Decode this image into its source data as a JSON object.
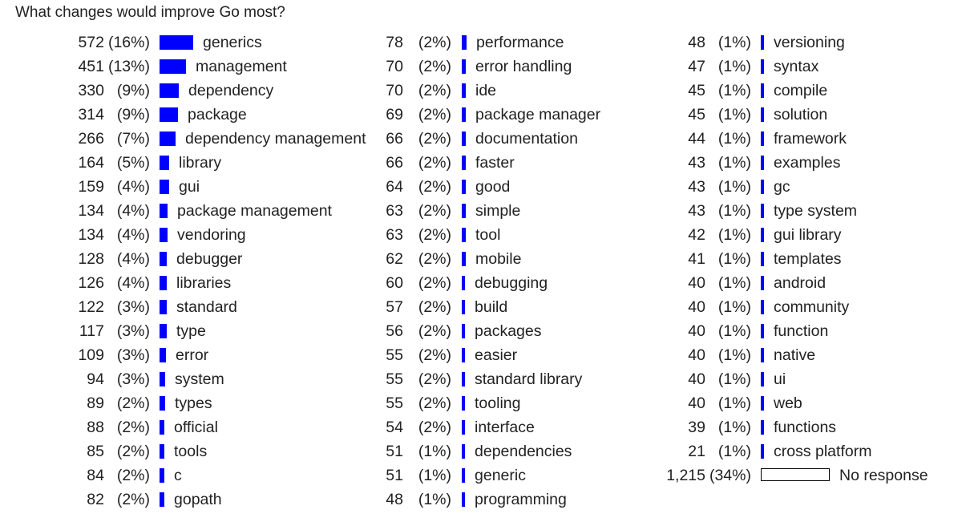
{
  "title": "What changes would improve Go most?",
  "colors": {
    "bar": "#0000ff",
    "no_response_bar": "#ffffff",
    "no_response_border": "#000000"
  },
  "chart_data": {
    "type": "bar",
    "orientation": "horizontal",
    "title": "What changes would improve Go most?",
    "bars": [
      {
        "label": "generics",
        "count": "572",
        "percent": "(16%)",
        "value": 572
      },
      {
        "label": "management",
        "count": "451",
        "percent": "(13%)",
        "value": 451
      },
      {
        "label": "dependency",
        "count": "330",
        "percent": "(9%)",
        "value": 330
      },
      {
        "label": "package",
        "count": "314",
        "percent": "(9%)",
        "value": 314
      },
      {
        "label": "dependency management",
        "count": "266",
        "percent": "(7%)",
        "value": 266
      },
      {
        "label": "library",
        "count": "164",
        "percent": "(5%)",
        "value": 164
      },
      {
        "label": "gui",
        "count": "159",
        "percent": "(4%)",
        "value": 159
      },
      {
        "label": "package management",
        "count": "134",
        "percent": "(4%)",
        "value": 134
      },
      {
        "label": "vendoring",
        "count": "134",
        "percent": "(4%)",
        "value": 134
      },
      {
        "label": "debugger",
        "count": "128",
        "percent": "(4%)",
        "value": 128
      },
      {
        "label": "libraries",
        "count": "126",
        "percent": "(4%)",
        "value": 126
      },
      {
        "label": "standard",
        "count": "122",
        "percent": "(3%)",
        "value": 122
      },
      {
        "label": "type",
        "count": "117",
        "percent": "(3%)",
        "value": 117
      },
      {
        "label": "error",
        "count": "109",
        "percent": "(3%)",
        "value": 109
      },
      {
        "label": "system",
        "count": "94",
        "percent": "(3%)",
        "value": 94
      },
      {
        "label": "types",
        "count": "89",
        "percent": "(2%)",
        "value": 89
      },
      {
        "label": "official",
        "count": "88",
        "percent": "(2%)",
        "value": 88
      },
      {
        "label": "tools",
        "count": "85",
        "percent": "(2%)",
        "value": 85
      },
      {
        "label": "c",
        "count": "84",
        "percent": "(2%)",
        "value": 84
      },
      {
        "label": "gopath",
        "count": "82",
        "percent": "(2%)",
        "value": 82
      },
      {
        "label": "performance",
        "count": "78",
        "percent": "(2%)",
        "value": 78
      },
      {
        "label": "error handling",
        "count": "70",
        "percent": "(2%)",
        "value": 70
      },
      {
        "label": "ide",
        "count": "70",
        "percent": "(2%)",
        "value": 70
      },
      {
        "label": "package manager",
        "count": "69",
        "percent": "(2%)",
        "value": 69
      },
      {
        "label": "documentation",
        "count": "66",
        "percent": "(2%)",
        "value": 66
      },
      {
        "label": "faster",
        "count": "66",
        "percent": "(2%)",
        "value": 66
      },
      {
        "label": "good",
        "count": "64",
        "percent": "(2%)",
        "value": 64
      },
      {
        "label": "simple",
        "count": "63",
        "percent": "(2%)",
        "value": 63
      },
      {
        "label": "tool",
        "count": "63",
        "percent": "(2%)",
        "value": 63
      },
      {
        "label": "mobile",
        "count": "62",
        "percent": "(2%)",
        "value": 62
      },
      {
        "label": "debugging",
        "count": "60",
        "percent": "(2%)",
        "value": 60
      },
      {
        "label": "build",
        "count": "57",
        "percent": "(2%)",
        "value": 57
      },
      {
        "label": "packages",
        "count": "56",
        "percent": "(2%)",
        "value": 56
      },
      {
        "label": "easier",
        "count": "55",
        "percent": "(2%)",
        "value": 55
      },
      {
        "label": "standard library",
        "count": "55",
        "percent": "(2%)",
        "value": 55
      },
      {
        "label": "tooling",
        "count": "55",
        "percent": "(2%)",
        "value": 55
      },
      {
        "label": "interface",
        "count": "54",
        "percent": "(2%)",
        "value": 54
      },
      {
        "label": "dependencies",
        "count": "51",
        "percent": "(1%)",
        "value": 51
      },
      {
        "label": "generic",
        "count": "51",
        "percent": "(1%)",
        "value": 51
      },
      {
        "label": "programming",
        "count": "48",
        "percent": "(1%)",
        "value": 48
      },
      {
        "label": "versioning",
        "count": "48",
        "percent": "(1%)",
        "value": 48
      },
      {
        "label": "syntax",
        "count": "47",
        "percent": "(1%)",
        "value": 47
      },
      {
        "label": "compile",
        "count": "45",
        "percent": "(1%)",
        "value": 45
      },
      {
        "label": "solution",
        "count": "45",
        "percent": "(1%)",
        "value": 45
      },
      {
        "label": "framework",
        "count": "44",
        "percent": "(1%)",
        "value": 44
      },
      {
        "label": "examples",
        "count": "43",
        "percent": "(1%)",
        "value": 43
      },
      {
        "label": "gc",
        "count": "43",
        "percent": "(1%)",
        "value": 43
      },
      {
        "label": "type system",
        "count": "43",
        "percent": "(1%)",
        "value": 43
      },
      {
        "label": "gui library",
        "count": "42",
        "percent": "(1%)",
        "value": 42
      },
      {
        "label": "templates",
        "count": "41",
        "percent": "(1%)",
        "value": 41
      },
      {
        "label": "android",
        "count": "40",
        "percent": "(1%)",
        "value": 40
      },
      {
        "label": "community",
        "count": "40",
        "percent": "(1%)",
        "value": 40
      },
      {
        "label": "function",
        "count": "40",
        "percent": "(1%)",
        "value": 40
      },
      {
        "label": "native",
        "count": "40",
        "percent": "(1%)",
        "value": 40
      },
      {
        "label": "ui",
        "count": "40",
        "percent": "(1%)",
        "value": 40
      },
      {
        "label": "web",
        "count": "40",
        "percent": "(1%)",
        "value": 40
      },
      {
        "label": "functions",
        "count": "39",
        "percent": "(1%)",
        "value": 39
      },
      {
        "label": "cross platform",
        "count": "21",
        "percent": "(1%)",
        "value": 21
      },
      {
        "label": "No response",
        "count": "1,215",
        "percent": "(34%)",
        "value": 1215,
        "no_response": true
      }
    ]
  }
}
